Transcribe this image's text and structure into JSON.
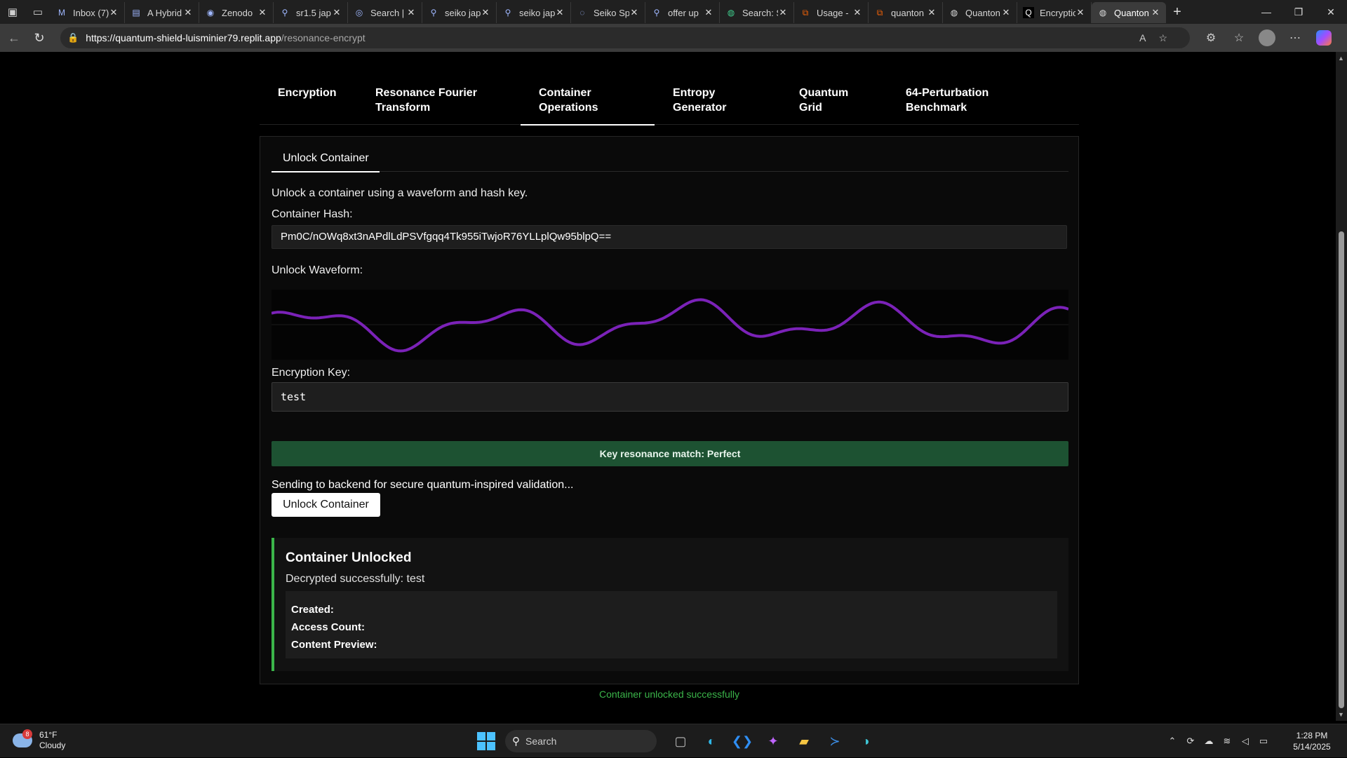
{
  "browser": {
    "tabs": [
      {
        "icon": "gmail-icon",
        "title": "Inbox (7)"
      },
      {
        "icon": "document-icon",
        "title": "A Hybrid"
      },
      {
        "icon": "zenodo-icon",
        "title": "Zenodo"
      },
      {
        "icon": "search-icon",
        "title": "sr1.5 jap"
      },
      {
        "icon": "search-icon",
        "title": "Search |"
      },
      {
        "icon": "search-icon",
        "title": "seiko jap"
      },
      {
        "icon": "search-icon",
        "title": "seiko jap"
      },
      {
        "icon": "loading-icon",
        "title": "Seiko Sp"
      },
      {
        "icon": "search-icon",
        "title": "offer up"
      },
      {
        "icon": "globe-icon",
        "title": "Search: S"
      },
      {
        "icon": "replit-icon",
        "title": "Usage -"
      },
      {
        "icon": "replit-icon",
        "title": "quanton"
      },
      {
        "icon": "globe-icon",
        "title": "Quanton"
      },
      {
        "icon": "q-icon",
        "title": "Encryptio"
      },
      {
        "icon": "globe-icon",
        "title": "Quanton",
        "active": true
      }
    ],
    "url_host": "https://quantum-shield-luisminier79.replit.app",
    "url_path": "/resonance-encrypt"
  },
  "nav": {
    "tabs": [
      {
        "label": "Encryption"
      },
      {
        "label": "Resonance Fourier Transform"
      },
      {
        "label": "Container Operations",
        "active": true
      },
      {
        "label": "Entropy Generator"
      },
      {
        "label": "Quantum Grid"
      },
      {
        "label": "64-Perturbation Benchmark"
      }
    ]
  },
  "container": {
    "subtab": "Unlock Container",
    "description": "Unlock a container using a waveform and hash key.",
    "hash_label": "Container Hash:",
    "hash_value": "Pm0C/nOWq8xt3nAPdlLdPSVfgqq4Tk955iTwjoR76YLLplQw95blpQ==",
    "waveform_label": "Unlock Waveform:",
    "key_label": "Encryption Key:",
    "key_value": "test",
    "match_text": "Key resonance match: Perfect",
    "sending_text": "Sending to backend for secure quantum-inspired validation...",
    "unlock_button": "Unlock Container",
    "result": {
      "title": "Container Unlocked",
      "message": "Decrypted successfully: test",
      "created_label": "Created:",
      "access_count_label": "Access Count:",
      "content_preview_label": "Content Preview:"
    },
    "status": "Container unlocked successfully"
  },
  "colors": {
    "waveform": "#7b22b8",
    "match_bg": "#1d5232",
    "success": "#3bb54a"
  },
  "taskbar": {
    "weather_temp": "61°F",
    "weather_desc": "Cloudy",
    "weather_badge": "8",
    "search_placeholder": "Search",
    "time": "1:28 PM",
    "date": "5/14/2025"
  }
}
